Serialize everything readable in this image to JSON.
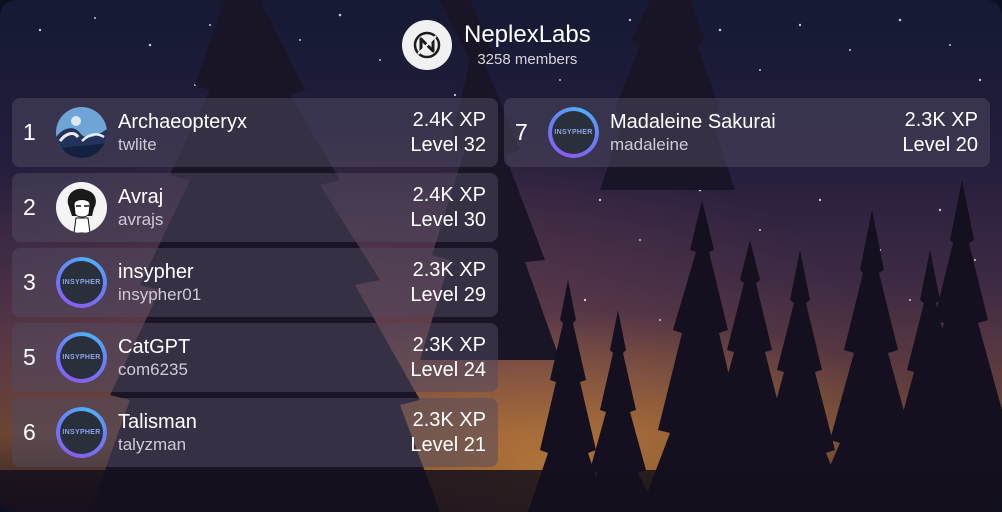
{
  "server": {
    "name": "NeplexLabs",
    "members": "3258 members",
    "logo_icon": "neplexlabs-logo-icon"
  },
  "colors": {
    "panel": "rgba(80,74,96,0.52)",
    "ring_start": "#8a5cf0",
    "ring_end": "#4fb0f7"
  },
  "leaderboard": [
    {
      "rank": "1",
      "display_name": "Archaeopteryx",
      "username": "twlite",
      "xp": "2.4K XP",
      "level": "Level 32",
      "avatar": "wave-painting-avatar"
    },
    {
      "rank": "2",
      "display_name": "Avraj",
      "username": "avrajs",
      "xp": "2.4K XP",
      "level": "Level 30",
      "avatar": "manga-character-avatar"
    },
    {
      "rank": "3",
      "display_name": "insypher",
      "username": "insypher01",
      "xp": "2.3K XP",
      "level": "Level 29",
      "avatar": "insypher-avatar",
      "avatar_text": "INSYPHER"
    },
    {
      "rank": "5",
      "display_name": "CatGPT",
      "username": "com6235",
      "xp": "2.3K XP",
      "level": "Level 24",
      "avatar": "insypher-avatar",
      "avatar_text": "INSYPHER"
    },
    {
      "rank": "6",
      "display_name": "Talisman",
      "username": "talyzman",
      "xp": "2.3K XP",
      "level": "Level 21",
      "avatar": "insypher-avatar",
      "avatar_text": "INSYPHER"
    },
    {
      "rank": "7",
      "display_name": "Madaleine Sakurai",
      "username": "madaleine",
      "xp": "2.3K XP",
      "level": "Level 20",
      "avatar": "insypher-avatar",
      "avatar_text": "INSYPHER"
    }
  ]
}
